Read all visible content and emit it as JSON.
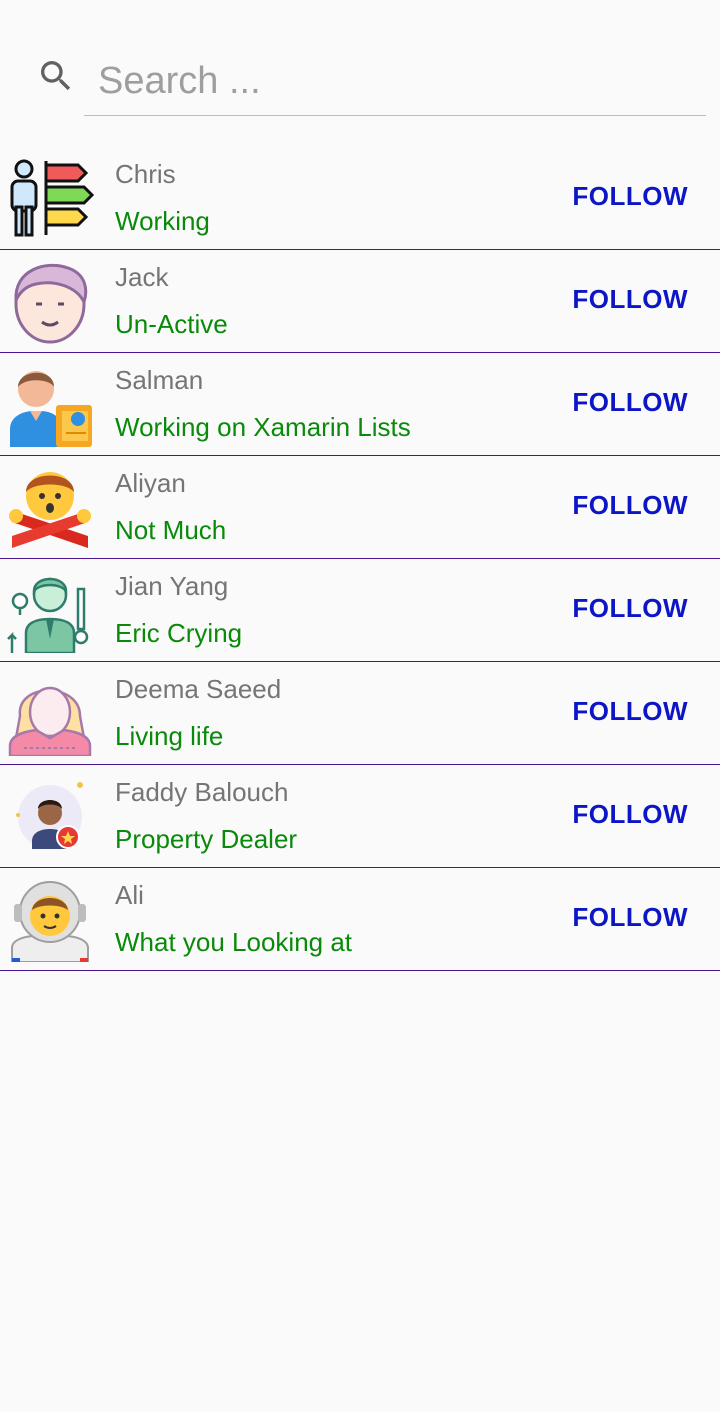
{
  "search": {
    "placeholder": "Search ..."
  },
  "contacts": [
    {
      "name": "Chris",
      "status": "Working",
      "action": "FOLLOW",
      "avatar_icon": "person-signpost-icon"
    },
    {
      "name": "Jack",
      "status": "Un-Active",
      "action": "FOLLOW",
      "avatar_icon": "man-face-icon"
    },
    {
      "name": "Salman",
      "status": "Working on Xamarin Lists",
      "action": "FOLLOW",
      "avatar_icon": "man-with-book-icon"
    },
    {
      "name": "Aliyan",
      "status": "Not Much",
      "action": "FOLLOW",
      "avatar_icon": "person-gesturing-no-icon"
    },
    {
      "name": "Jian Yang",
      "status": "Eric Crying",
      "action": "FOLLOW",
      "avatar_icon": "businessman-ideas-icon"
    },
    {
      "name": "Deema Saeed",
      "status": "Living life",
      "action": "FOLLOW",
      "avatar_icon": "woman-avatar-icon"
    },
    {
      "name": "Faddy Balouch",
      "status": "Property Dealer",
      "action": "FOLLOW",
      "avatar_icon": "man-with-badge-icon"
    },
    {
      "name": "Ali",
      "status": "What you Looking at",
      "action": "FOLLOW",
      "avatar_icon": "astronaut-icon"
    }
  ],
  "colors": {
    "name_text": "#757575",
    "status_text": "#0a8a0a",
    "follow_text": "#0d16c6",
    "row_divider": "#4a148c",
    "background": "#fafafa"
  }
}
